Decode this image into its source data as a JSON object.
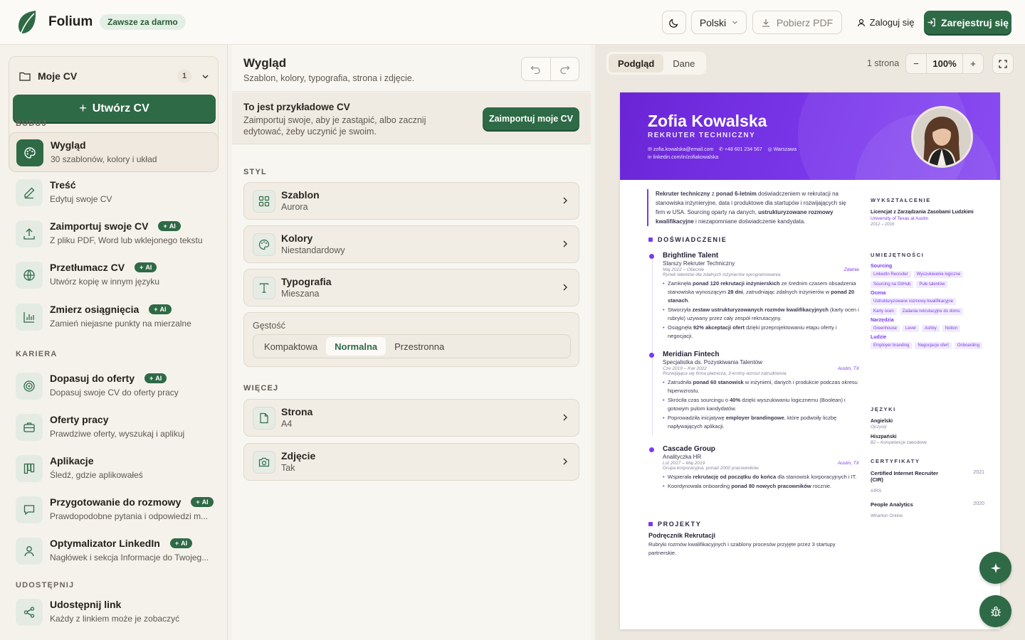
{
  "header": {
    "brand": "Folium",
    "free_badge": "Zawsze za darmo",
    "language": "Polski",
    "download_pdf": "Pobierz PDF",
    "login": "Zaloguj się",
    "register": "Zarejestruj się"
  },
  "sidebar": {
    "my_cv": "Moje CV",
    "cv_count": "1",
    "create_cv": "Utwórz CV",
    "sections": {
      "build": "BUDUJ",
      "career": "KARIERA",
      "share": "UDOSTĘPNIJ"
    },
    "ai_badge": "AI",
    "items": [
      {
        "title": "Wygląd",
        "sub": "30 szablonów, kolory i układ",
        "icon": "palette-icon",
        "ai": false
      },
      {
        "title": "Treść",
        "sub": "Edytuj swoje CV",
        "icon": "pencil-icon",
        "ai": false
      },
      {
        "title": "Zaimportuj swoje CV",
        "sub": "Z pliku PDF, Word lub wklejonego tekstu",
        "icon": "upload-icon",
        "ai": true
      },
      {
        "title": "Przetłumacz CV",
        "sub": "Utwórz kopię w innym języku",
        "icon": "globe-icon",
        "ai": true
      },
      {
        "title": "Zmierz osiągnięcia",
        "sub": "Zamień niejasne punkty na mierzalne",
        "icon": "bar-chart-icon",
        "ai": true
      },
      {
        "title": "Dopasuj do oferty",
        "sub": "Dopasuj swoje CV do oferty pracy",
        "icon": "target-icon",
        "ai": true
      },
      {
        "title": "Oferty pracy",
        "sub": "Prawdziwe oferty, wyszukaj i aplikuj",
        "icon": "briefcase-icon",
        "ai": false
      },
      {
        "title": "Aplikacje",
        "sub": "Śledź, gdzie aplikowałeś",
        "icon": "kanban-icon",
        "ai": false
      },
      {
        "title": "Przygotowanie do rozmowy",
        "sub": "Prawdopodobne pytania i odpowiedzi m...",
        "icon": "chat-icon",
        "ai": true
      },
      {
        "title": "Optymalizator LinkedIn",
        "sub": "Nagłówek i sekcja Informacje do Twojeg...",
        "icon": "user-icon",
        "ai": true
      },
      {
        "title": "Udostępnij link",
        "sub": "Każdy z linkiem może je zobaczyć",
        "icon": "share-icon",
        "ai": false
      }
    ]
  },
  "panel": {
    "title": "Wygląd",
    "subtitle": "Szablon, kolory, typografia, strona i zdjęcie.",
    "banner_title": "To jest przykładowe CV",
    "banner_text": "Zaimportuj swoje, aby je zastąpić, albo zacznij edytować, żeby uczynić je swoim.",
    "import_button": "Zaimportuj moje CV",
    "style_label": "STYL",
    "more_label": "WIĘCEJ",
    "template": {
      "title": "Szablon",
      "value": "Aurora"
    },
    "colors": {
      "title": "Kolory",
      "value": "Niestandardowy"
    },
    "typography": {
      "title": "Typografia",
      "value": "Mieszana"
    },
    "density": {
      "label": "Gęstość",
      "options": [
        "Kompaktowa",
        "Normalna",
        "Przestronna"
      ],
      "selected": "Normalna"
    },
    "page": {
      "title": "Strona",
      "value": "A4"
    },
    "photo": {
      "title": "Zdjęcie",
      "value": "Tak"
    }
  },
  "preview": {
    "tab_preview": "Podgląd",
    "tab_data": "Dane",
    "pages": "1 strona",
    "zoom": "100%",
    "accent_color": "#7c3aed"
  },
  "cv": {
    "name": "Zofia Kowalska",
    "role": "REKRUTER TECHNICZNY",
    "email": "zofia.kowalska@email.com",
    "phone": "+48 601 234 567",
    "city": "Warszawa",
    "linkedin": "linkedin.com/in/zofiakowalska",
    "summary_html": "<b>Rekruter techniczny</b> z <b>ponad 6-letnim</b> doświadczeniem w rekrutacji na stanowiska inżynieryjne, data i produktowe dla startupów i rozwijających się firm w USA. Sourcing oparty na danych, <b>ustrukturyzowane rozmowy kwalifikacyjne</b> i niezapomniane doświadczenie kandydata.",
    "experience_label": "DOŚWIADCZENIE",
    "projects_label": "PROJEKTY",
    "jobs": [
      {
        "company": "Brightline Talent",
        "role": "Starszy Rekruter Techniczny",
        "dates": "Maj 2022 – Obecnie",
        "place": "Zdalnie",
        "desc": "Rynek talentów dla zdalnych inżynierów oprogramowania.",
        "bullets": [
          "Zamknęła <b>ponad 120 rekrutacji inżynierskich</b> ze średnim czasem obsadzenia stanowiska wynoszącym <b>28 dni</b>, zatrudniając zdalnych inżynierów w <b>ponad 20 stanach</b>.",
          "Stworzyła <b>zestaw ustrukturyzowanych rozmów kwalifikacyjnych</b> (karty ocen i rubryki) używany przez cały zespół rekrutacyjny.",
          "Osiągnęła <b>92% akceptacji ofert</b> dzięki przeprojektowaniu etapu oferty i negocjacji."
        ]
      },
      {
        "company": "Meridian Fintech",
        "role": "Specjalistka ds. Pozyskiwania Talentów",
        "dates": "Cze 2019 – Kwi 2022",
        "place": "Austin, TX",
        "desc": "Rozwijająca się firma płatnicza, 3-krotny wzrost zatrudnienia.",
        "bullets": [
          "Zatrudniła <b>ponad 60 stanowisk</b> w inżynierii, danych i produkcie podczas okresu hiperwzrostu.",
          "Skróciła czas sourcingu o <b>40%</b> dzięki wyszukiwaniu logicznemu (Boolean) i gotowym pulom kandydatów.",
          "Poprowadziła inicjatywę <b>employer brandingowe</b>, które podwoiły liczbę napływających aplikacji."
        ]
      },
      {
        "company": "Cascade Group",
        "role": "Analityczka HR",
        "dates": "Lut 2017 – Maj 2019",
        "place": "Austin, TX",
        "desc": "Grupa korporacyjna, ponad 2000 pracowników.",
        "bullets": [
          "Wspierała <b>rekrutację od początku do końca</b> dla stanowisk korporacyjnych i IT.",
          "Koordynowała onboarding <b>ponad 80 nowych pracowników</b> rocznie."
        ]
      }
    ],
    "project": {
      "title": "Podręcznik Rekrutacji",
      "desc": "Rubryki rozmów kwalifikacyjnych i szablony procesów przyjęte przez 3 startupy partnerskie."
    },
    "education_label": "WYKSZTAŁCENIE",
    "education": {
      "degree": "Licencjat z Zarządzania Zasobami Ludzkimi",
      "school": "University of Texas at Austin",
      "years": "2012 – 2016"
    },
    "skills_label": "UMIEJĘTNOŚCI",
    "skills": [
      {
        "group": "Sourcing",
        "items": [
          "LinkedIn Recruiter",
          "Wyszukiwanie logiczne",
          "Sourcing na GitHub",
          "Pule talentów"
        ]
      },
      {
        "group": "Ocena",
        "items": [
          "Ustrukturyzowane rozmowy kwalifikacyjne",
          "Karty ocen",
          "Zadania rekrutacyjne do domu"
        ]
      },
      {
        "group": "Narzędzia",
        "items": [
          "Greenhouse",
          "Lever",
          "Ashby",
          "Notion"
        ]
      },
      {
        "group": "Ludzie",
        "items": [
          "Employer branding",
          "Negocjacje ofert",
          "Onboarding"
        ]
      }
    ],
    "languages_label": "JĘZYKI",
    "languages": [
      {
        "name": "Angielski",
        "level": "Ojczysty"
      },
      {
        "name": "Hiszpański",
        "level": "B2 – Kompetencje zawodowe"
      }
    ],
    "certs_label": "CERTYFIKATY",
    "certs": [
      {
        "name": "Certified Internet Recruiter (CIR)",
        "org": "AIRS",
        "year": "2021"
      },
      {
        "name": "People Analytics",
        "org": "Wharton Online",
        "year": "2020"
      }
    ]
  }
}
